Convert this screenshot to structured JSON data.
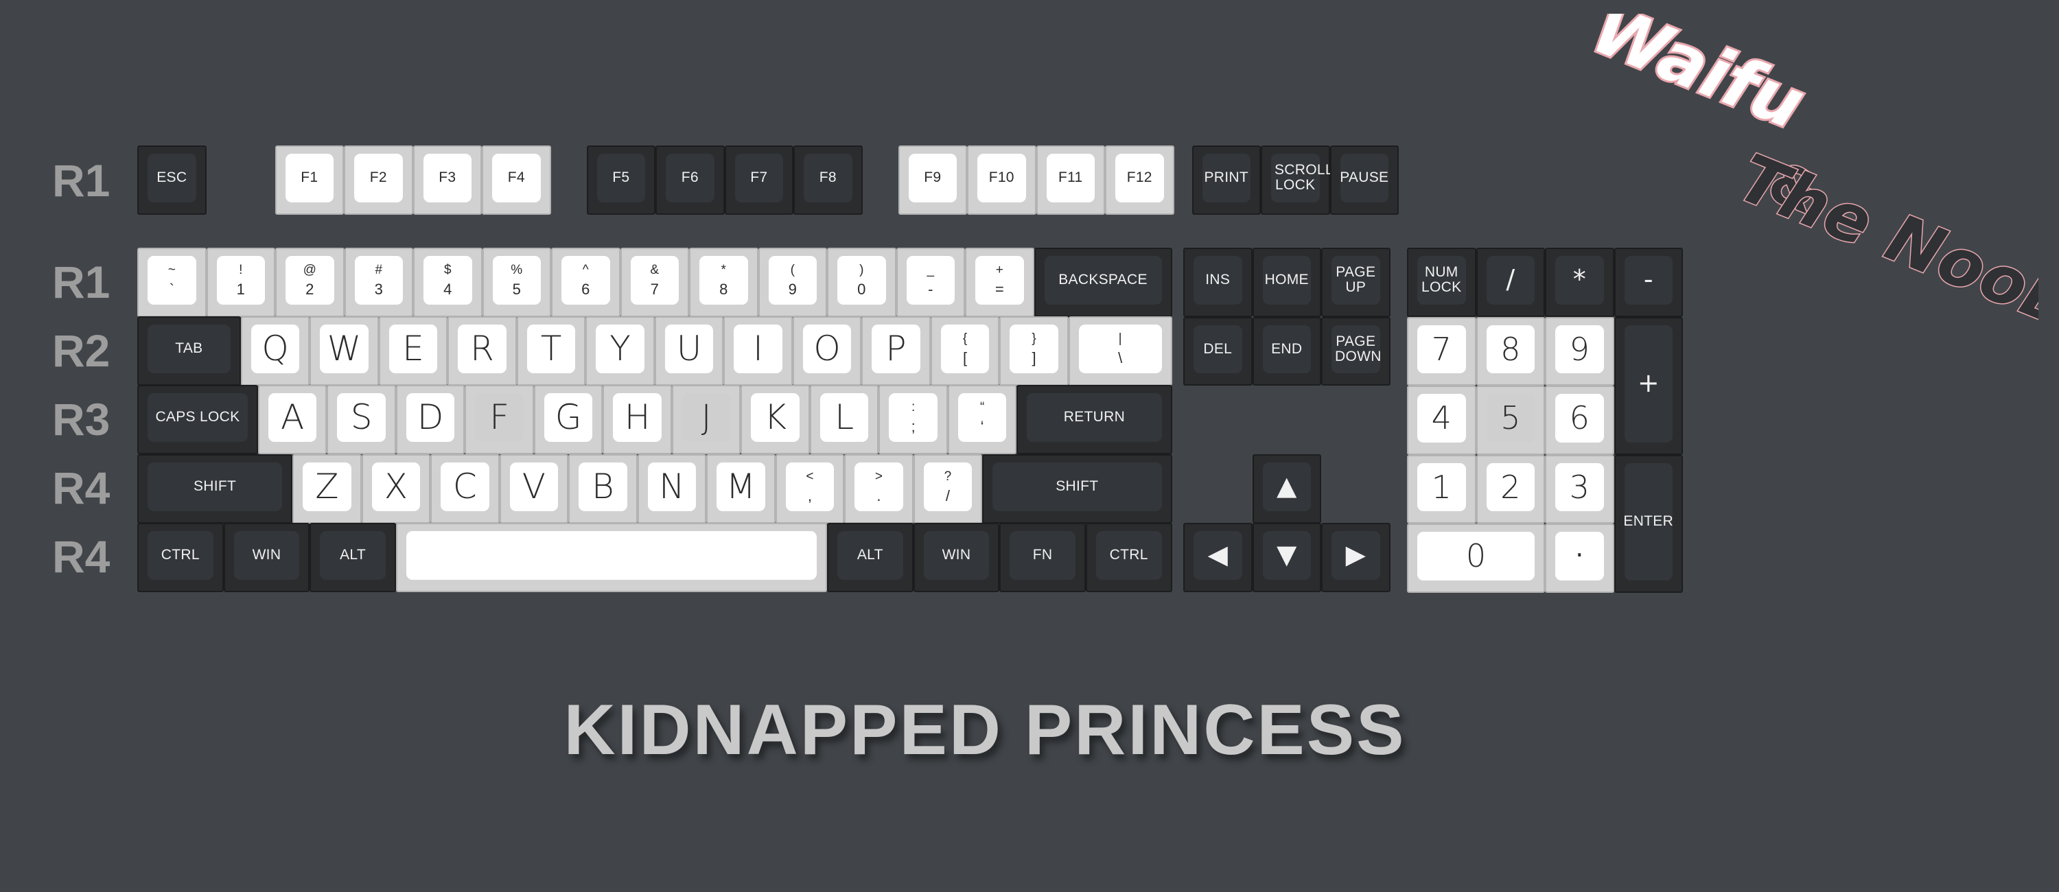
{
  "row_labels": [
    "R1",
    "R1",
    "R2",
    "R3",
    "R4",
    "R4"
  ],
  "title": "KIDNAPPED PRINCESS",
  "brand": {
    "line1": "Waifu",
    "line2": "&",
    "line3": "The NooB"
  },
  "colors": {
    "background": "#414549",
    "dark_key": "#2a2c2e",
    "light_key": "#d1d1d1",
    "legend_light": "#ffffff",
    "logo_pink": "#e9a7ae",
    "logo_dark": "#2f3134"
  },
  "keys": {
    "fn_row": [
      {
        "label": "ESC",
        "style": "dark"
      },
      {
        "label": "F1",
        "style": "light"
      },
      {
        "label": "F2",
        "style": "light"
      },
      {
        "label": "F3",
        "style": "light"
      },
      {
        "label": "F4",
        "style": "light"
      },
      {
        "label": "F5",
        "style": "dark"
      },
      {
        "label": "F6",
        "style": "dark"
      },
      {
        "label": "F7",
        "style": "dark"
      },
      {
        "label": "F8",
        "style": "dark"
      },
      {
        "label": "F9",
        "style": "light"
      },
      {
        "label": "F10",
        "style": "light"
      },
      {
        "label": "F11",
        "style": "light"
      },
      {
        "label": "F12",
        "style": "light"
      },
      {
        "label": "PRINT",
        "style": "dark"
      },
      {
        "label": "SCROLL LOCK",
        "style": "dark"
      },
      {
        "label": "PAUSE",
        "style": "dark"
      }
    ],
    "number_row": [
      {
        "shift": "~",
        "base": "`",
        "style": "light"
      },
      {
        "shift": "!",
        "base": "1",
        "style": "light"
      },
      {
        "shift": "@",
        "base": "2",
        "style": "light"
      },
      {
        "shift": "#",
        "base": "3",
        "style": "light"
      },
      {
        "shift": "$",
        "base": "4",
        "style": "light"
      },
      {
        "shift": "%",
        "base": "5",
        "style": "light"
      },
      {
        "shift": "^",
        "base": "6",
        "style": "light"
      },
      {
        "shift": "&",
        "base": "7",
        "style": "light"
      },
      {
        "shift": "*",
        "base": "8",
        "style": "light"
      },
      {
        "shift": "(",
        "base": "9",
        "style": "light"
      },
      {
        "shift": ")",
        "base": "0",
        "style": "light"
      },
      {
        "shift": "_",
        "base": "-",
        "style": "light"
      },
      {
        "shift": "+",
        "base": "=",
        "style": "light"
      },
      {
        "label": "BACKSPACE",
        "style": "dark"
      }
    ],
    "top_row": [
      {
        "label": "TAB",
        "style": "dark"
      },
      {
        "label": "Q",
        "style": "light"
      },
      {
        "label": "W",
        "style": "light"
      },
      {
        "label": "E",
        "style": "light"
      },
      {
        "label": "R",
        "style": "light"
      },
      {
        "label": "T",
        "style": "light"
      },
      {
        "label": "Y",
        "style": "light"
      },
      {
        "label": "U",
        "style": "light"
      },
      {
        "label": "I",
        "style": "light"
      },
      {
        "label": "O",
        "style": "light"
      },
      {
        "label": "P",
        "style": "light"
      },
      {
        "shift": "{",
        "base": "[",
        "style": "light"
      },
      {
        "shift": "}",
        "base": "]",
        "style": "light"
      },
      {
        "shift": "|",
        "base": "\\",
        "style": "light"
      }
    ],
    "home_row": [
      {
        "label": "CAPS LOCK",
        "style": "dark"
      },
      {
        "label": "A",
        "style": "light"
      },
      {
        "label": "S",
        "style": "light"
      },
      {
        "label": "D",
        "style": "light"
      },
      {
        "label": "F",
        "style": "light",
        "homing": true
      },
      {
        "label": "G",
        "style": "light"
      },
      {
        "label": "H",
        "style": "light"
      },
      {
        "label": "J",
        "style": "light",
        "homing": true
      },
      {
        "label": "K",
        "style": "light"
      },
      {
        "label": "L",
        "style": "light"
      },
      {
        "shift": ":",
        "base": ";",
        "style": "light"
      },
      {
        "shift": "“",
        "base": "‘",
        "style": "light"
      },
      {
        "label": "RETURN",
        "style": "dark"
      }
    ],
    "bottom_row": [
      {
        "label": "SHIFT",
        "style": "dark"
      },
      {
        "label": "Z",
        "style": "light"
      },
      {
        "label": "X",
        "style": "light"
      },
      {
        "label": "C",
        "style": "light"
      },
      {
        "label": "V",
        "style": "light"
      },
      {
        "label": "B",
        "style": "light"
      },
      {
        "label": "N",
        "style": "light"
      },
      {
        "label": "M",
        "style": "light"
      },
      {
        "shift": "<",
        "base": ",",
        "style": "light"
      },
      {
        "shift": ">",
        "base": ".",
        "style": "light"
      },
      {
        "shift": "?",
        "base": "/",
        "style": "light"
      },
      {
        "label": "SHIFT",
        "style": "dark"
      }
    ],
    "space_row": [
      {
        "label": "CTRL",
        "style": "dark"
      },
      {
        "label": "WIN",
        "style": "dark"
      },
      {
        "label": "ALT",
        "style": "dark"
      },
      {
        "label": "",
        "style": "light"
      },
      {
        "label": "ALT",
        "style": "dark"
      },
      {
        "label": "WIN",
        "style": "dark"
      },
      {
        "label": "FN",
        "style": "dark"
      },
      {
        "label": "CTRL",
        "style": "dark"
      }
    ],
    "nav_cluster": [
      {
        "label": "INS",
        "style": "dark"
      },
      {
        "label": "HOME",
        "style": "dark"
      },
      {
        "label": "PAGE UP",
        "style": "dark"
      },
      {
        "label": "DEL",
        "style": "dark"
      },
      {
        "label": "END",
        "style": "dark"
      },
      {
        "label": "PAGE DOWN",
        "style": "dark"
      }
    ],
    "arrows": [
      {
        "label": "▲",
        "style": "dark"
      },
      {
        "label": "◀",
        "style": "dark"
      },
      {
        "label": "▼",
        "style": "dark"
      },
      {
        "label": "▶",
        "style": "dark"
      }
    ],
    "numpad": [
      {
        "label": "NUM LOCK",
        "style": "dark"
      },
      {
        "label": "/",
        "style": "dark"
      },
      {
        "label": "*",
        "style": "dark"
      },
      {
        "label": "-",
        "style": "dark"
      },
      {
        "label": "7",
        "style": "light"
      },
      {
        "label": "8",
        "style": "light"
      },
      {
        "label": "9",
        "style": "light"
      },
      {
        "label": "+",
        "style": "dark"
      },
      {
        "label": "4",
        "style": "light"
      },
      {
        "label": "5",
        "style": "light",
        "homing": true
      },
      {
        "label": "6",
        "style": "light"
      },
      {
        "label": "1",
        "style": "light"
      },
      {
        "label": "2",
        "style": "light"
      },
      {
        "label": "3",
        "style": "light"
      },
      {
        "label": "ENTER",
        "style": "dark"
      },
      {
        "label": "0",
        "style": "light"
      },
      {
        "label": "·",
        "style": "light"
      }
    ]
  }
}
